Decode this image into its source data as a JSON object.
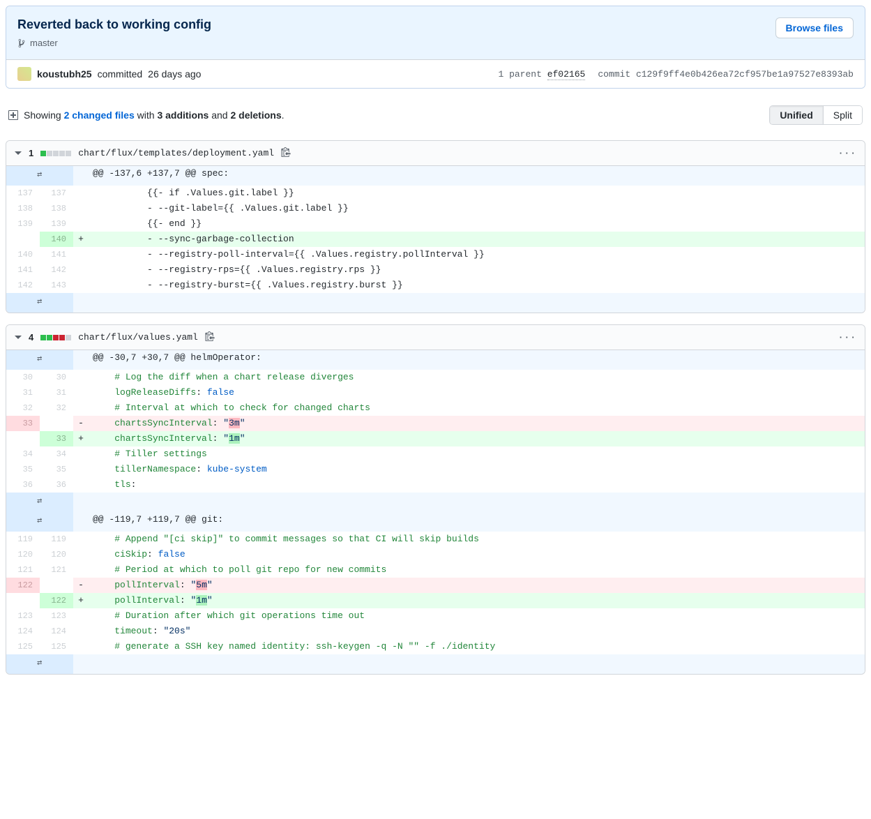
{
  "commit": {
    "title": "Reverted back to working config",
    "branch": "master",
    "browse_files": "Browse files",
    "author": "koustubh25",
    "committed_verb": "committed",
    "rel_time": "26 days ago",
    "parents_label": "1 parent",
    "parent_sha": "ef02165",
    "commit_label": "commit",
    "full_sha": "c129f9ff4e0b426ea72cf957be1a97527e8393ab"
  },
  "summary": {
    "showing": "Showing",
    "changed_files": "2 changed files",
    "with": "with",
    "additions": "3 additions",
    "and": "and",
    "deletions": "2 deletions",
    "unified": "Unified",
    "split": "Split"
  },
  "files": [
    {
      "stat": "1",
      "blocks": [
        "g",
        "n",
        "n",
        "n",
        "n"
      ],
      "path": "chart/flux/templates/deployment.yaml",
      "hunks": [
        {
          "header": "@@ -137,6 +137,7 @@ spec:",
          "lines": [
            {
              "t": "ctx",
              "lo": "137",
              "ln": "137",
              "code": "          {{- if .Values.git.label }}"
            },
            {
              "t": "ctx",
              "lo": "138",
              "ln": "138",
              "code": "          - --git-label={{ .Values.git.label }}"
            },
            {
              "t": "ctx",
              "lo": "139",
              "ln": "139",
              "code": "          {{- end }}"
            },
            {
              "t": "add",
              "lo": "",
              "ln": "140",
              "code": "          - --sync-garbage-collection"
            },
            {
              "t": "ctx",
              "lo": "140",
              "ln": "141",
              "code": "          - --registry-poll-interval={{ .Values.registry.pollInterval }}"
            },
            {
              "t": "ctx",
              "lo": "141",
              "ln": "142",
              "code": "          - --registry-rps={{ .Values.registry.rps }}"
            },
            {
              "t": "ctx",
              "lo": "142",
              "ln": "143",
              "code": "          - --registry-burst={{ .Values.registry.burst }}"
            }
          ],
          "expand_top": true,
          "expand_bottom": true
        }
      ]
    },
    {
      "stat": "4",
      "blocks": [
        "g",
        "g",
        "r",
        "r",
        "n"
      ],
      "path": "chart/flux/values.yaml",
      "hunks": [
        {
          "header": "@@ -30,7 +30,7 @@ helmOperator:",
          "lines": [
            {
              "t": "ctx",
              "lo": "30",
              "ln": "30",
              "html": "    <span class='tok-yaml'># Log the diff when a chart release diverges</span>"
            },
            {
              "t": "ctx",
              "lo": "31",
              "ln": "31",
              "html": "    <span class='tok-yaml'>logReleaseDiffs</span>: <span class='tok-bool'>false</span>"
            },
            {
              "t": "ctx",
              "lo": "32",
              "ln": "32",
              "html": "    <span class='tok-yaml'># Interval at which to check for changed charts</span>"
            },
            {
              "t": "del",
              "lo": "33",
              "ln": "",
              "html": "    <span class='tok-yaml'>chartsSyncInterval</span>: <span class='tok-str'><span class=''>\"</span><span class='hl-del'>3m</span><span class=''>\"</span></span>"
            },
            {
              "t": "add",
              "lo": "",
              "ln": "33",
              "html": "    <span class='tok-yaml'>chartsSyncInterval</span>: <span class='tok-str'><span class=''>\"</span><span class='hl-add'>1m</span><span class=''>\"</span></span>"
            },
            {
              "t": "ctx",
              "lo": "34",
              "ln": "34",
              "html": "    <span class='tok-yaml'># Tiller settings</span>"
            },
            {
              "t": "ctx",
              "lo": "35",
              "ln": "35",
              "html": "    <span class='tok-yaml'>tillerNamespace</span>: <span class='tok-bool'>kube-system</span>"
            },
            {
              "t": "ctx",
              "lo": "36",
              "ln": "36",
              "html": "    <span class='tok-yaml'>tls</span>:"
            }
          ],
          "expand_top": true,
          "expand_bottom": false
        },
        {
          "header": "@@ -119,7 +119,7 @@ git:",
          "lines": [
            {
              "t": "ctx",
              "lo": "119",
              "ln": "119",
              "html": "    <span class='tok-yaml'># Append \"[ci skip]\" to commit messages so that CI will skip builds</span>"
            },
            {
              "t": "ctx",
              "lo": "120",
              "ln": "120",
              "html": "    <span class='tok-yaml'>ciSkip</span>: <span class='tok-bool'>false</span>"
            },
            {
              "t": "ctx",
              "lo": "121",
              "ln": "121",
              "html": "    <span class='tok-yaml'># Period at which to poll git repo for new commits</span>"
            },
            {
              "t": "del",
              "lo": "122",
              "ln": "",
              "html": "    <span class='tok-yaml'>pollInterval</span>: <span class='tok-str'><span class=''>\"</span><span class='hl-del'>5m</span><span class=''>\"</span></span>"
            },
            {
              "t": "add",
              "lo": "",
              "ln": "122",
              "html": "    <span class='tok-yaml'>pollInterval</span>: <span class='tok-str'><span class=''>\"</span><span class='hl-add'>1m</span><span class=''>\"</span></span>"
            },
            {
              "t": "ctx",
              "lo": "123",
              "ln": "123",
              "html": "    <span class='tok-yaml'># Duration after which git operations time out</span>"
            },
            {
              "t": "ctx",
              "lo": "124",
              "ln": "124",
              "html": "    <span class='tok-yaml'>timeout</span>: <span class='tok-str'>\"20s\"</span>"
            },
            {
              "t": "ctx",
              "lo": "125",
              "ln": "125",
              "html": "    <span class='tok-yaml'># generate a SSH key named identity: ssh-keygen -q -N \"\" -f ./identity</span>"
            }
          ],
          "expand_top": true,
          "expand_bottom": true,
          "mid_expand": true
        }
      ]
    }
  ]
}
